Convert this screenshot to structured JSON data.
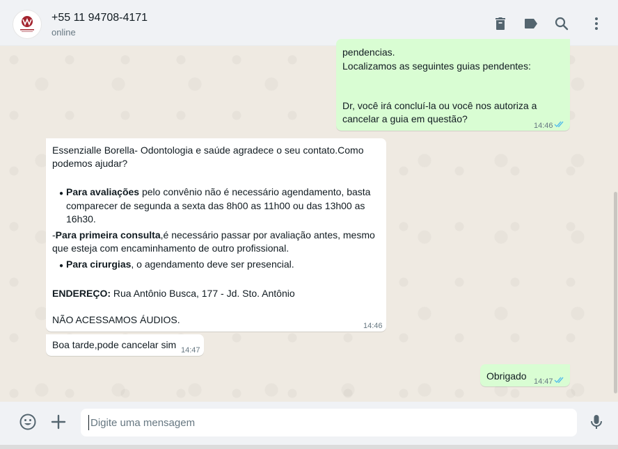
{
  "header": {
    "contact_name": "+55 11 94708-4171",
    "status": "online",
    "icons": [
      "delete-icon",
      "label-icon",
      "search-icon",
      "menu-icon"
    ]
  },
  "messages": {
    "m1": {
      "direction": "outgoing",
      "lines": [
        "pendencias.",
        "Localizamos as seguintes guias pendentes:",
        "Dr, você irá concluí-la ou você nos autoriza a",
        "cancelar a guia em questão?"
      ],
      "time": "14:46",
      "read": true
    },
    "m2": {
      "direction": "incoming",
      "intro": [
        "Essenzialle Borella- Odontologia e saúde agradece o seu contato.Como",
        "podemos ajudar?"
      ],
      "b1_bold": "Para avaliações",
      "b1_rest": " pelo convênio não é necessário agendamento, basta",
      "b1_l2": "comparecer de segunda a sexta das 8h00 as 11h00 ou das 13h00 as",
      "b1_l3": "16h30.",
      "p2_prefix": "-",
      "p2_bold": "Para primeira consulta",
      "p2_rest": ",é necessário passar por avaliação antes, mesmo",
      "p2_l2": "que esteja com encaminhamento de outro profissional.",
      "b2_bold": "Para cirurgias",
      "b2_rest": ", o agendamento deve ser presencial.",
      "addr_bold": "ENDEREÇO:",
      "addr_rest": " Rua Antônio Busca, 177 - Jd. Sto. Antônio",
      "audio": "NÃO ACESSAMOS ÁUDIOS.",
      "time": "14:46"
    },
    "m3": {
      "direction": "incoming",
      "text": "Boa tarde,pode cancelar sim",
      "time": "14:47"
    },
    "m4": {
      "direction": "outgoing",
      "text": "Obrigado",
      "time": "14:47",
      "read": true
    }
  },
  "footer": {
    "placeholder": "Digite uma mensagem",
    "icons": [
      "emoji-icon",
      "attach-plus-icon",
      "microphone-icon"
    ]
  },
  "colors": {
    "outgoing_bubble": "#d9fdd3",
    "incoming_bubble": "#ffffff",
    "chat_background": "#efeae2",
    "read_ticks": "#53bdeb",
    "logo": "#a3242f"
  }
}
